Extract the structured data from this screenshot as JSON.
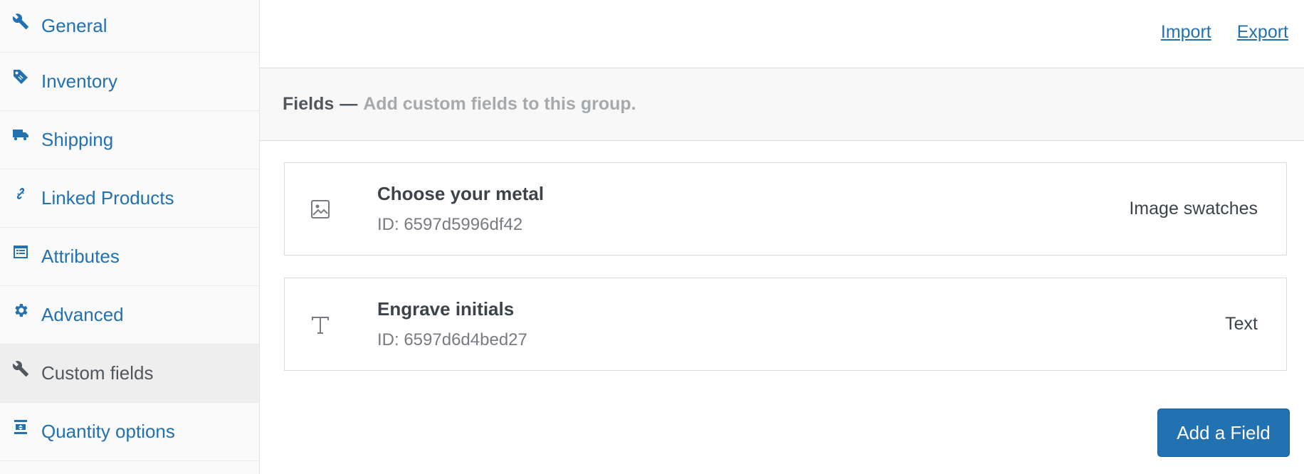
{
  "sidebar": {
    "items": [
      {
        "label": "General",
        "icon": "wrench-icon"
      },
      {
        "label": "Inventory",
        "icon": "tag-icon"
      },
      {
        "label": "Shipping",
        "icon": "truck-icon"
      },
      {
        "label": "Linked Products",
        "icon": "link-icon"
      },
      {
        "label": "Attributes",
        "icon": "list-card-icon"
      },
      {
        "label": "Advanced",
        "icon": "gear-icon"
      },
      {
        "label": "Custom fields",
        "icon": "wrench-icon",
        "active": true
      },
      {
        "label": "Quantity options",
        "icon": "quantity-icon"
      }
    ]
  },
  "topbar": {
    "import_label": "Import",
    "export_label": "Export"
  },
  "fields_header": {
    "title": "Fields",
    "separator": "—",
    "description": "Add custom fields to this group."
  },
  "fields": [
    {
      "name": "Choose your metal",
      "id_text": "ID: 6597d5996df42",
      "type": "Image swatches",
      "icon": "image-icon"
    },
    {
      "name": "Engrave initials",
      "id_text": "ID: 6597d6d4bed27",
      "type": "Text",
      "icon": "text-type-icon"
    }
  ],
  "add_button_label": "Add a Field",
  "colors": {
    "accent": "#2271b1",
    "sidebar_bg": "#fafafa",
    "active_bg": "#eeeeee",
    "muted_text": "#a7aaad"
  }
}
